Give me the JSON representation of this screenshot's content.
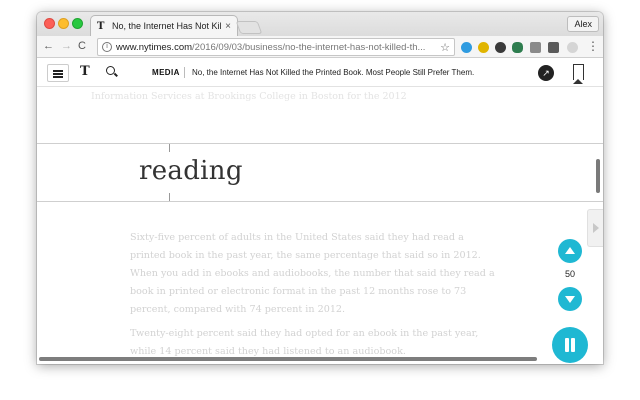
{
  "browser": {
    "tab_title": "No, the Internet Has Not Killed",
    "tab_favicon": "T",
    "tab_close": "×",
    "profile_name": "Alex",
    "url_host": "www.nytimes.com",
    "url_path": "/2016/09/03/business/no-the-internet-has-not-killed-th...",
    "back": "←",
    "forward": "→",
    "reload": "C",
    "star": "☆",
    "menu": "⋮"
  },
  "nyt_header": {
    "logo": "T",
    "section": "MEDIA",
    "headline": "No, the Internet Has Not Killed the Printed Book. Most People Still Prefer Them.",
    "share": "↗"
  },
  "reader": {
    "faded_top_line": "Information Services at Brookings College in Boston for the 2012",
    "focus_word": "reading",
    "paragraph_1": "Sixty-five percent of adults in the United States said they had read a printed book in the past year, the same percentage that said so in 2012. When you add in ebooks and audiobooks, the number that said they read a book in printed or electronic format in the past 12 months rose to 73 percent, compared with 74 percent in 2012.",
    "paragraph_2": "Twenty-eight percent said they had opted for an ebook in the past year, while 14 percent said they had listened to an audiobook.",
    "speed_value": "50"
  },
  "colors": {
    "accent": "#1fb8d3"
  }
}
